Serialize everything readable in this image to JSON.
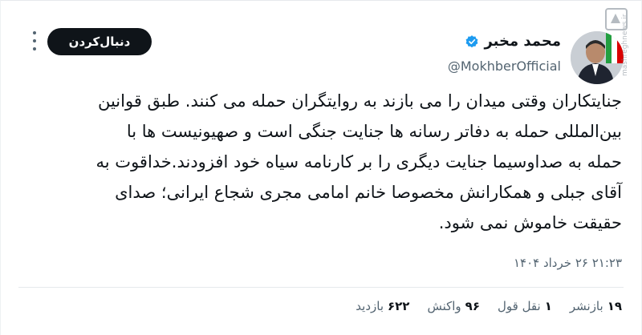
{
  "author": {
    "name": "محمد مخبر",
    "handle": "@MokhberOfficial",
    "verified_color": "#1d9bf0"
  },
  "watermark_text": "mashreghnews.ir",
  "follow_button_label": "دنبال‌کردن",
  "more_icon": "more-vertical-icon",
  "tweet_lines": [
    "جنایتکاران وقتی میدان را می بازند به روایتگران حمله می کنند. طبق قوانین",
    "بین‌المللی حمله به دفاتر رسانه ها جنایت جنگی است و صهیونیست ها با",
    "حمله به صداوسیما جنایت دیگری را بر کارنامه سیاه خود افزودند.خداقوت به",
    "آقای جبلی و همکارانش مخصوصا خانم امامی مجری شجاع ایرانی؛ صدای",
    "حقیقت خاموش نمی شود."
  ],
  "timestamp": "۲۱:۲۳ ۲۶ خرداد ۱۴۰۴",
  "stats": [
    {
      "num": "۱۹",
      "label": "بازنشر"
    },
    {
      "num": "۱",
      "label": "نقل قول"
    },
    {
      "num": "۹۶",
      "label": "واکنش"
    },
    {
      "num": "۶۲۲",
      "label": "بازدید"
    }
  ]
}
